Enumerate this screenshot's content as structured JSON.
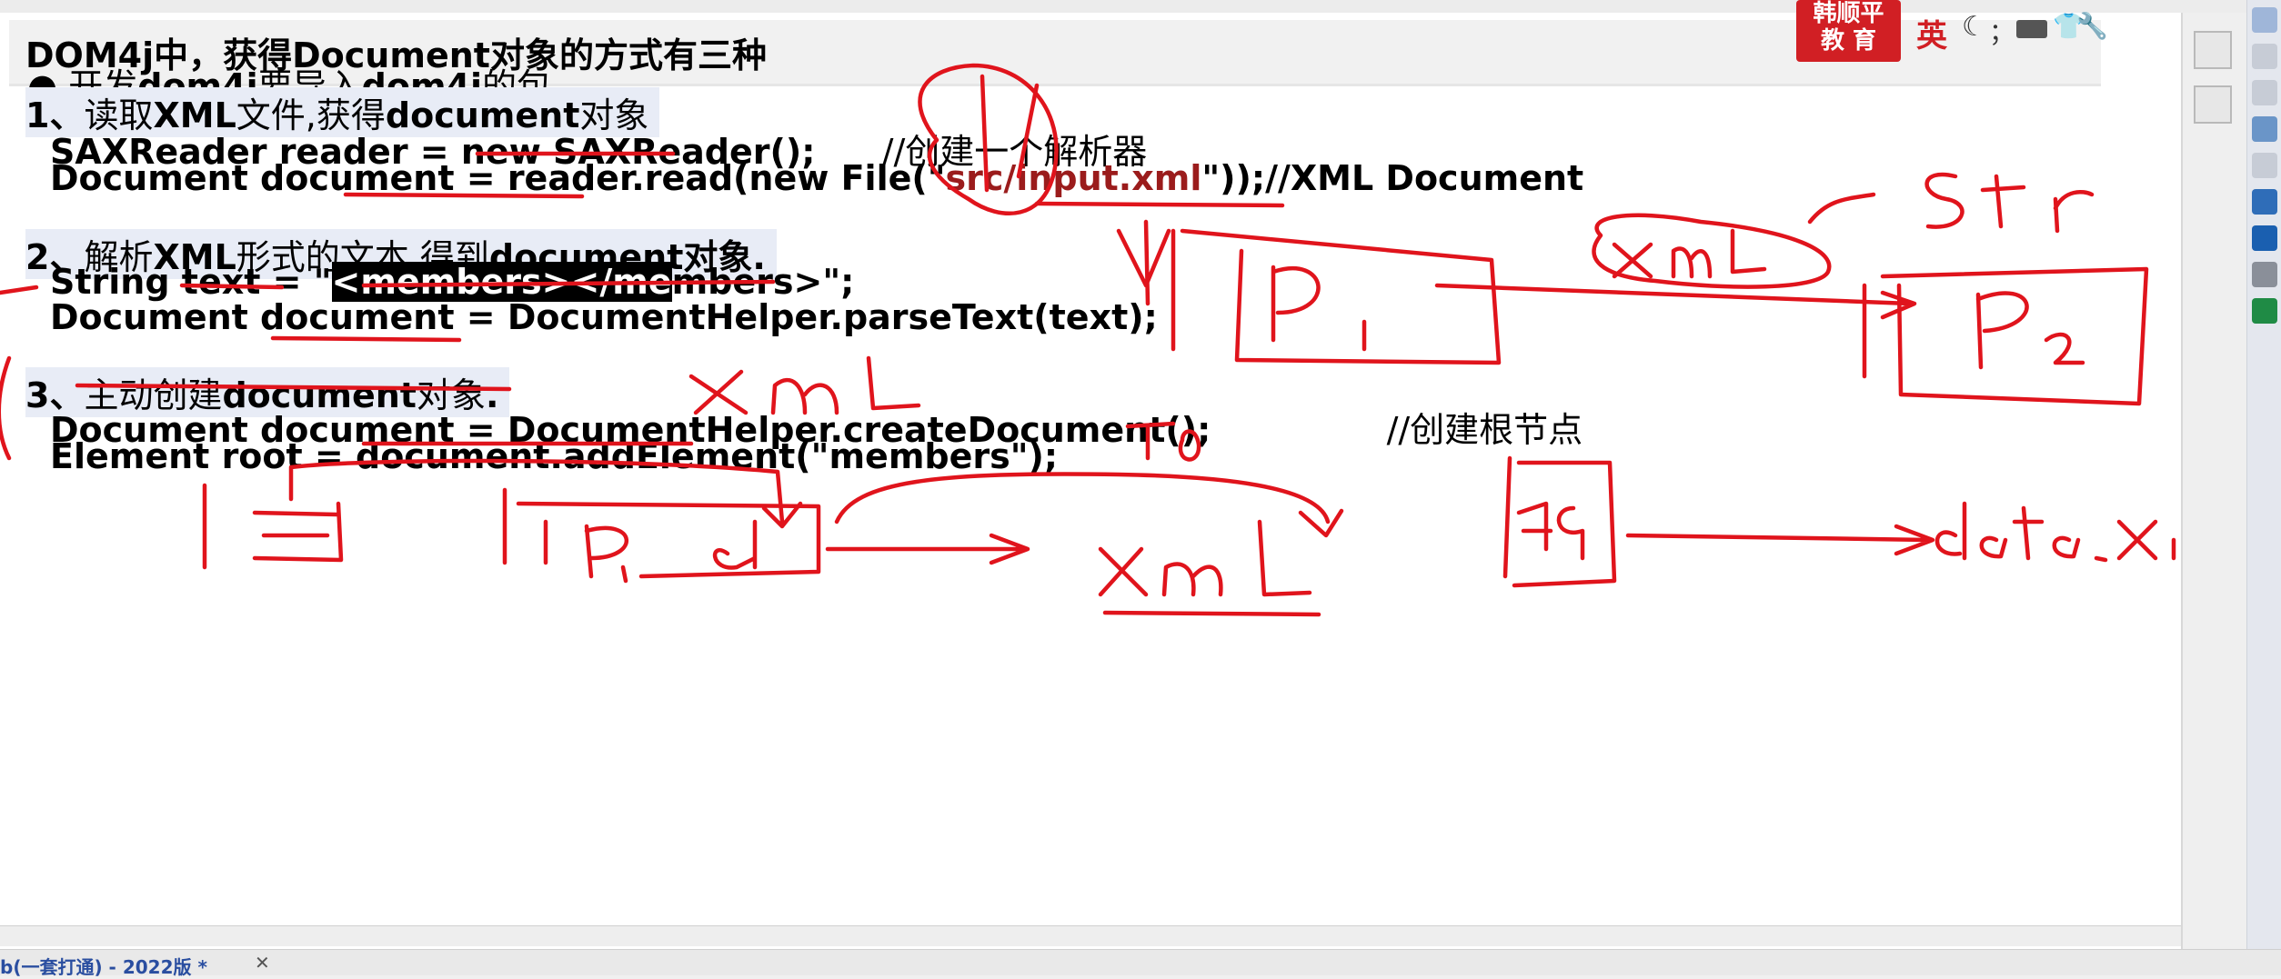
{
  "title": "DOM4j中，获得Document对象的方式有三种",
  "brand": {
    "line1": "韩顺平",
    "line2": "教 育"
  },
  "ime": {
    "lang": "英",
    "punct": "；"
  },
  "content": {
    "bullet": "● 开发",
    "bullet_b1": "dom4j",
    "bullet_mid": "要导入",
    "bullet_b2": "dom4j",
    "bullet_end": "的包",
    "s1_num": "1、",
    "s1_a": "读取",
    "s1_b": "XML",
    "s1_c": "文件,获得",
    "s1_d": "document",
    "s1_e": "对象",
    "s1_code1": "SAXReader reader = new SAXReader();",
    "s1_comment1": "//创建一个解析器",
    "s1_code2a": "Document   document = reader.read(new File(\"",
    "s1_code2b": "src/input.xml",
    "s1_code2c": "\"));//XML Document",
    "s2_num": "2、",
    "s2_a": "解析",
    "s2_b": "XML",
    "s2_c": "形式的文本,得到",
    "s2_d": "document",
    "s2_e": "对象.",
    "s2_code1a": "String text = \"",
    "s2_code1b": "<members></me",
    "s2_code1c": "mbers>\";",
    "s2_code2": "Document document = DocumentHelper.parseText(text);",
    "s3_num": "3、",
    "s3_a": "主动创建",
    "s3_b": "document",
    "s3_c": "对象",
    "s3_d": ".",
    "s3_code1": "Document document = DocumentHelper.createDocument();",
    "s3_comment1": "//创建根节点",
    "s3_code2": "Element root = document.addElement(\"members\");"
  },
  "bottom_tab": "b(一套打通) - 2022版 *",
  "colors": {
    "ink": "#e0141c",
    "brand": "#d11f24",
    "selection": "#000000"
  }
}
